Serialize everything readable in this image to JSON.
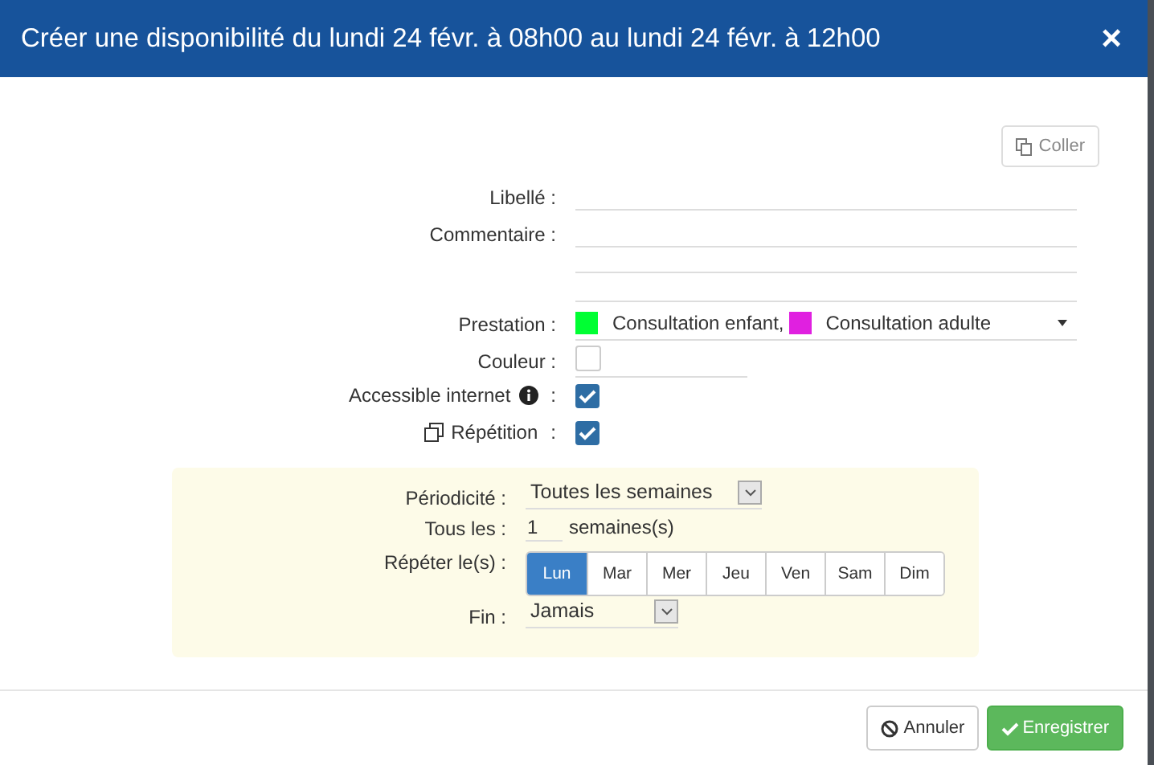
{
  "dialog": {
    "title": "Créer une disponibilité du lundi 24 févr. à 08h00 au lundi 24 févr. à 12h00",
    "close": "×"
  },
  "paste_button": {
    "label": "Coller"
  },
  "fields": [
    {
      "kind": "text",
      "label": "Libellé :"
    },
    {
      "kind": "textarea",
      "label": "Commentaire :"
    },
    {
      "kind": "services",
      "label": "Prestation :",
      "services": [
        {
          "name": "Consultation enfant,",
          "color": "#00ff33"
        },
        {
          "name": "Consultation adulte",
          "color": "#e020e0"
        }
      ]
    },
    {
      "kind": "color",
      "label": "Couleur :"
    },
    {
      "kind": "infocheck",
      "label": "Accessible internet",
      "suffix": ":",
      "checked": true
    },
    {
      "kind": "repeatcheck",
      "label": "Répétition",
      "suffix": ":",
      "checked": true
    }
  ],
  "repetition": {
    "periodicity": {
      "label": "Périodicité :",
      "value": "Toutes les semaines"
    },
    "every": {
      "label": "Tous les :",
      "value": "1",
      "unit": "semaines(s)"
    },
    "days_label": "Répéter le(s) :",
    "days": [
      {
        "label": "Lun",
        "selected": true
      },
      {
        "label": "Mar",
        "selected": false
      },
      {
        "label": "Mer",
        "selected": false
      },
      {
        "label": "Jeu",
        "selected": false
      },
      {
        "label": "Ven",
        "selected": false
      },
      {
        "label": "Sam",
        "selected": false
      },
      {
        "label": "Dim",
        "selected": false
      }
    ],
    "end": {
      "label": "Fin :",
      "value": "Jamais"
    }
  },
  "footer": {
    "cancel": "Annuler",
    "save": "Enregistrer"
  }
}
